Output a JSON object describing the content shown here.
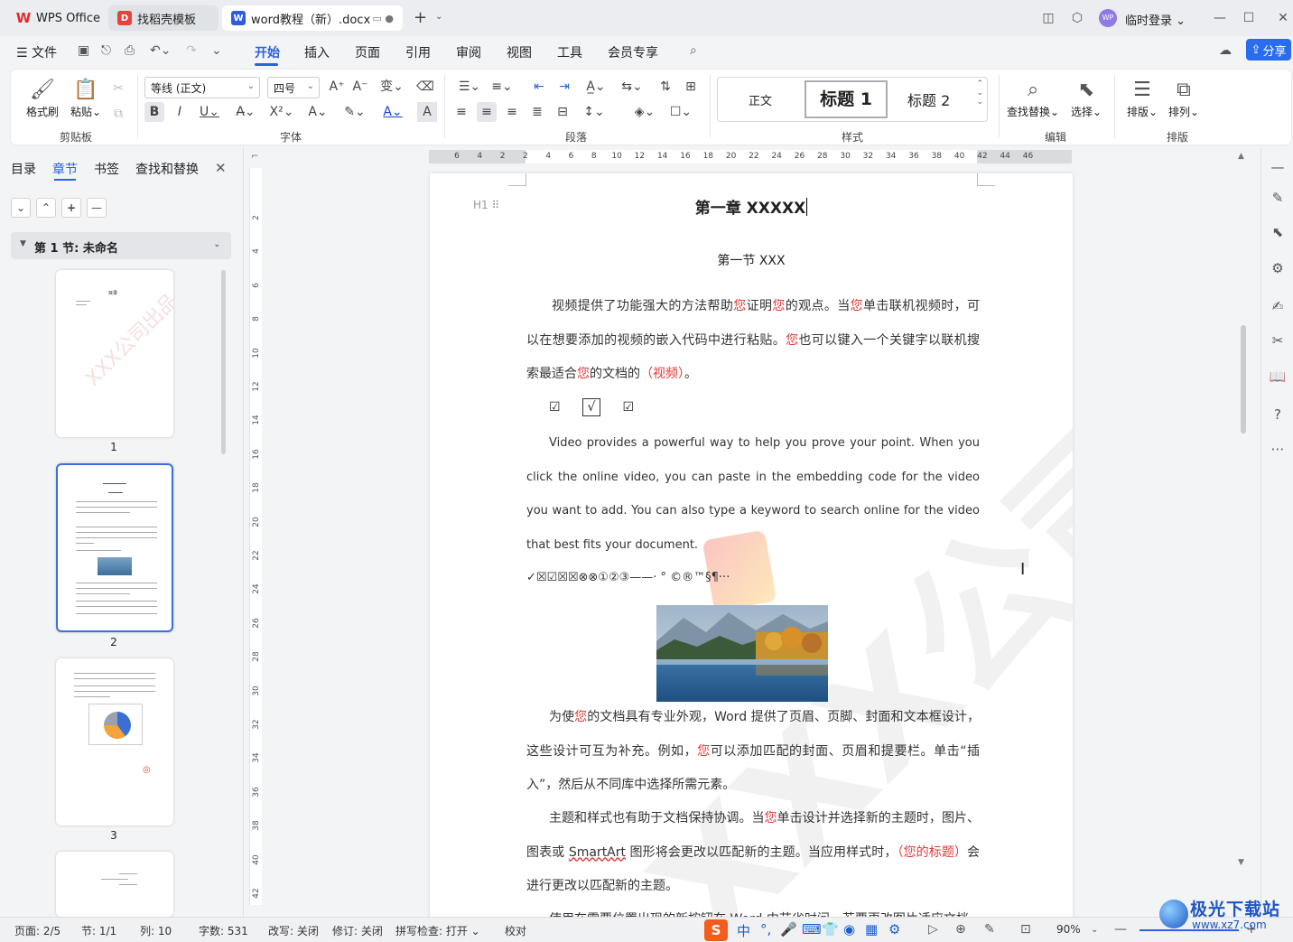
{
  "tabs": [
    {
      "label": "WPS Office"
    },
    {
      "label": "找稻壳模板"
    },
    {
      "label": "word教程（新）.docx"
    }
  ],
  "account": {
    "avatar_text": "WP",
    "login_label": "临时登录"
  },
  "menu": {
    "file": "文件",
    "items": [
      "开始",
      "插入",
      "页面",
      "引用",
      "审阅",
      "视图",
      "工具",
      "会员专享"
    ],
    "active": "开始",
    "share": "分享"
  },
  "ribbon": {
    "clipboard": {
      "format_painter": "格式刷",
      "paste": "粘贴",
      "group_label": "剪贴板"
    },
    "font": {
      "font_name": "等线 (正文)",
      "font_size": "四号",
      "group_label": "字体"
    },
    "paragraph": {
      "group_label": "段落"
    },
    "styles": {
      "normal": "正文",
      "heading1": "标题 1",
      "heading2": "标题 2",
      "group_label": "样式"
    },
    "editing": {
      "find_replace": "查找替换",
      "select": "选择",
      "group_label": "编辑"
    },
    "arrange": {
      "layout": "排版",
      "arrange": "排列",
      "group_label": "排版"
    }
  },
  "nav": {
    "tabs": [
      "目录",
      "章节",
      "书签",
      "查找和替换"
    ],
    "active_tab": "章节",
    "section": "第 1 节: 未命名",
    "thumb_title": "目录",
    "thumb_watermark": "XXX公司出品",
    "pages": [
      "1",
      "2",
      "3"
    ]
  },
  "ruler": {
    "h_ticks": [
      "6",
      "4",
      "2",
      "2",
      "4",
      "6",
      "8",
      "10",
      "12",
      "14",
      "16",
      "18",
      "20",
      "22",
      "24",
      "26",
      "28",
      "30",
      "32",
      "34",
      "36",
      "38",
      "40",
      "42",
      "44",
      "46"
    ],
    "v_ticks": [
      "2",
      "4",
      "6",
      "8",
      "10",
      "12",
      "14",
      "16",
      "18",
      "20",
      "22",
      "24",
      "26",
      "28",
      "30",
      "32",
      "34",
      "36",
      "38",
      "40",
      "42"
    ]
  },
  "document": {
    "h1_marker": "H1",
    "chapter_title": "第一章  XXXXX",
    "section_title": "第一节  XXX",
    "para1": [
      {
        "t": "视频提供了功能强大的方法帮助"
      },
      {
        "t": "您",
        "red": true
      },
      {
        "t": "证明"
      },
      {
        "t": "您",
        "red": true
      },
      {
        "t": "的观点。当"
      },
      {
        "t": "您",
        "red": true
      },
      {
        "t": "单击联机视频时，可以在想要添加的视频的嵌入代码中进行粘贴。"
      },
      {
        "t": "您",
        "red": true
      },
      {
        "t": "也可以键入一个关键字以联机搜索最适合"
      },
      {
        "t": "您",
        "red": true
      },
      {
        "t": "的文档的"
      },
      {
        "t": "（视频）",
        "red": true
      },
      {
        "t": "。"
      }
    ],
    "checkboxes": [
      "☑",
      "√",
      "☑"
    ],
    "para2": "Video provides a powerful way to help you prove your point. When you click the online video, you can paste in the embedding code for the video you want to add. You can also type a keyword to search online for the video that best fits your document.",
    "symbols": "✓☒☑☒☒⊗⊗①②③——·   °   ©®™§¶···",
    "para3": [
      {
        "t": "为使"
      },
      {
        "t": "您",
        "red": true
      },
      {
        "t": "的文档具有专业外观，Word 提供了页眉、页脚、封面和文本框设计，这些设计可互为补充。例如，"
      },
      {
        "t": "您",
        "red": true
      },
      {
        "t": "可以添加匹配的封面、页眉和提要栏。单击“插入”，然后从不同库中选择所需元素。"
      }
    ],
    "para4": [
      {
        "t": "主题和样式也有助于文档保持协调。当"
      },
      {
        "t": "您",
        "red": true
      },
      {
        "t": "单击设计并选择新的主题时，图片、图表或 "
      },
      {
        "t": "SmartArt",
        "wavy": true
      },
      {
        "t": " 图形将会更改以匹配新的主题。当应用样式时，"
      },
      {
        "t": "（您的标题）",
        "red": true
      },
      {
        "t": "会进行更改以匹配新的主题。"
      }
    ],
    "para5": "使用在需要位置出现的新按钮在 Word 中节省时间。若要更改图片适应文档",
    "watermark": "XXX公司出品"
  },
  "status": {
    "page": "页面: 2/5",
    "section": "节: 1/1",
    "column": "列: 10",
    "word_count": "字数: 531",
    "overtype": "改写: 关闭",
    "revision": "修订: 关闭",
    "spellcheck": "拼写检查: 打开",
    "proof": "校对",
    "ime": "中",
    "zoom": "90%"
  },
  "site_logo": {
    "name": "极光下载站",
    "url": "www.xz7.com"
  },
  "colors": {
    "accent": "#2a62d9",
    "red_text": "#e03a3a",
    "share": "#2a6cf0"
  }
}
